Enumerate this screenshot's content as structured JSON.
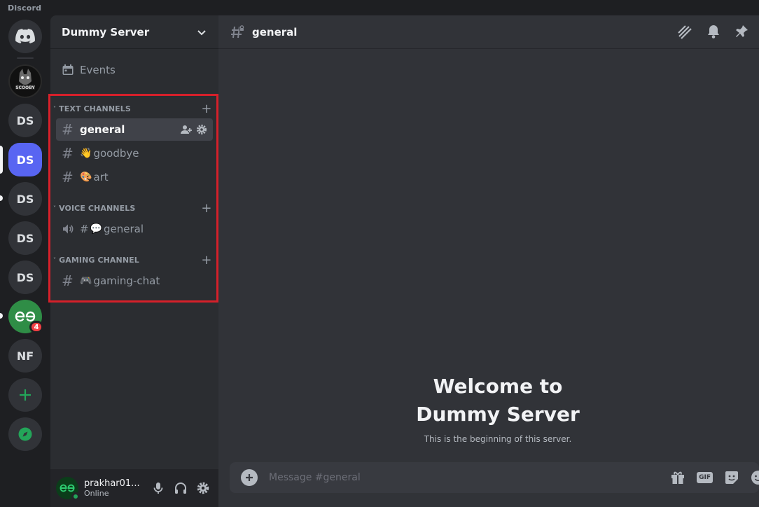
{
  "app": {
    "title": "Discord"
  },
  "servers": [
    {
      "abbr": ""
    },
    {
      "abbr": ""
    },
    {
      "abbr": "DS"
    },
    {
      "abbr": "DS"
    },
    {
      "abbr": "DS"
    },
    {
      "abbr": "DS"
    },
    {
      "abbr": "DS"
    },
    {
      "abbr": "",
      "badge": "4"
    },
    {
      "abbr": "NF"
    }
  ],
  "sidebar": {
    "server_name": "Dummy Server",
    "events_label": "Events",
    "categories": [
      {
        "label": "TEXT CHANNELS"
      },
      {
        "label": "VOICE CHANNELS"
      },
      {
        "label": "GAMING CHANNEL"
      }
    ],
    "channels": [
      {
        "prefix": "#",
        "emoji": "",
        "name": "general"
      },
      {
        "prefix": "#",
        "emoji": "👋",
        "name": "goodbye"
      },
      {
        "prefix": "#",
        "emoji": "🎨",
        "name": "art"
      },
      {
        "prefix": "#",
        "emoji": "💬",
        "name": "general"
      },
      {
        "prefix": "#",
        "emoji": "🎮",
        "name": "gaming-chat"
      }
    ]
  },
  "user": {
    "name": "prakhar01...",
    "status": "Online"
  },
  "main": {
    "channel_title": "general",
    "welcome_line1": "Welcome to",
    "welcome_line2": "Dummy Server",
    "welcome_sub": "This is the beginning of this server.",
    "message_placeholder": "Message #general",
    "gif_label": "GIF"
  },
  "colors": {
    "accent": "#5865f2",
    "highlight_box": "#d6202a",
    "online": "#23a559",
    "badge": "#f23f43"
  }
}
